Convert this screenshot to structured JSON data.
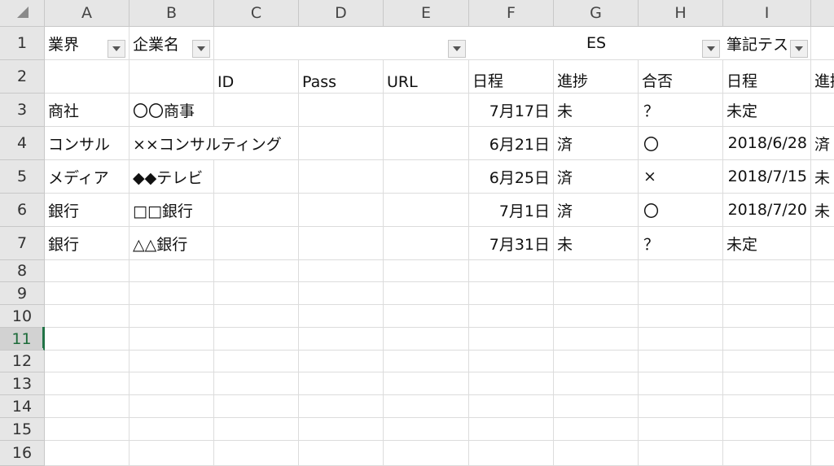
{
  "columns": [
    "A",
    "B",
    "C",
    "D",
    "E",
    "F",
    "G",
    "H",
    "I"
  ],
  "row_numbers": [
    "1",
    "2",
    "3",
    "4",
    "5",
    "6",
    "7",
    "8",
    "9",
    "10",
    "11",
    "12",
    "13",
    "14",
    "15",
    "16"
  ],
  "active_row": "11",
  "row1": {
    "a1": "業界",
    "b1": "企業名",
    "es": "ES",
    "i1": "筆記テス"
  },
  "row2": {
    "c2": "ID",
    "d2": "Pass",
    "e2": "URL",
    "f2": "日程",
    "g2": "進捗",
    "h2": "合否",
    "i2": "日程",
    "j2": "進捗"
  },
  "rows": [
    {
      "a": "商社",
      "b": "〇〇商事",
      "f": "7月17日",
      "g": "未",
      "h": "？",
      "i": "未定",
      "j": ""
    },
    {
      "a": "コンサル",
      "b": "××コンサルティング",
      "f": "6月21日",
      "g": "済",
      "h": "〇",
      "i": "2018/6/28",
      "j": "済"
    },
    {
      "a": "メディア",
      "b": "◆◆テレビ",
      "f": "6月25日",
      "g": "済",
      "h": "×",
      "i": "2018/7/15",
      "j": "未"
    },
    {
      "a": "銀行",
      "b": "□□銀行",
      "f": "7月1日",
      "g": "済",
      "h": "〇",
      "i": "2018/7/20",
      "j": "未"
    },
    {
      "a": "銀行",
      "b": "△△銀行",
      "f": "7月31日",
      "g": "未",
      "h": "？",
      "i": "未定",
      "j": ""
    }
  ]
}
